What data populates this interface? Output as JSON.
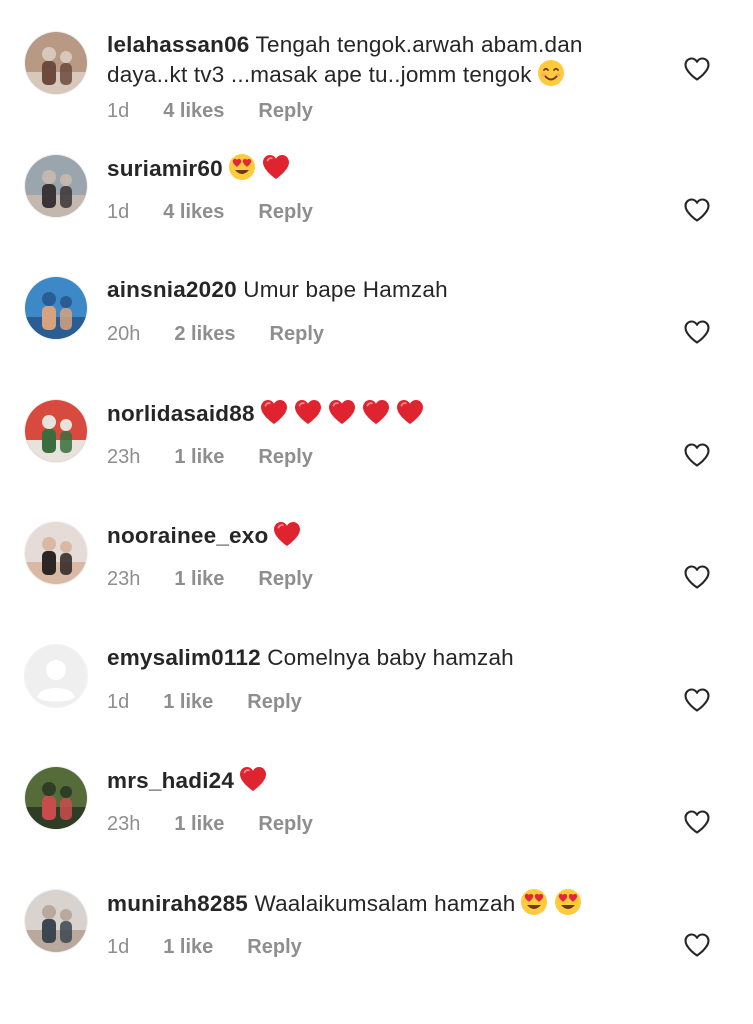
{
  "comments": [
    {
      "username": "lelahassan06",
      "text": "Tengah tengok.arwah abam.dan daya..kt  tv3 ...masak ape tu..jomm tengok",
      "emojis": [
        "smiling-face-emoji"
      ],
      "time": "1d",
      "likes": "4 likes",
      "reply": "Reply",
      "avatar_colors": [
        "#b89a84",
        "#6d4a3c",
        "#d7c8bb"
      ]
    },
    {
      "username": "suriamir60",
      "text": "",
      "emojis": [
        "heart-eyes-emoji",
        "red-heart-emoji"
      ],
      "time": "1d",
      "likes": "4 likes",
      "reply": "Reply",
      "avatar_colors": [
        "#9aa5ad",
        "#3b3436",
        "#c4b8ae"
      ]
    },
    {
      "username": "ainsnia2020",
      "text": "Umur bape Hamzah",
      "emojis": [],
      "time": "20h",
      "likes": "2 likes",
      "reply": "Reply",
      "avatar_colors": [
        "#3d88c7",
        "#d7a27d",
        "#2a5d93"
      ]
    },
    {
      "username": "norlidasaid88",
      "text": "",
      "emojis": [
        "red-heart-emoji",
        "red-heart-emoji",
        "red-heart-emoji",
        "red-heart-emoji",
        "red-heart-emoji"
      ],
      "time": "23h",
      "likes": "1 like",
      "reply": "Reply",
      "avatar_colors": [
        "#d94a3e",
        "#3a6d3d",
        "#e8e2dc"
      ]
    },
    {
      "username": "noorainee_exo",
      "text": "",
      "emojis": [
        "red-heart-emoji"
      ],
      "time": "23h",
      "likes": "1 like",
      "reply": "Reply",
      "avatar_colors": [
        "#e5dcd7",
        "#2d2524",
        "#d9b9a4"
      ]
    },
    {
      "username": "emysalim0112",
      "text": "Comelnya baby hamzah",
      "emojis": [],
      "time": "1d",
      "likes": "1 like",
      "reply": "Reply",
      "avatar_colors": [
        "#eeeeee",
        "#ffffff",
        "#ffffff"
      ]
    },
    {
      "username": "mrs_hadi24",
      "text": "",
      "emojis": [
        "red-heart-emoji"
      ],
      "time": "23h",
      "likes": "1 like",
      "reply": "Reply",
      "avatar_colors": [
        "#556b3a",
        "#c94c4c",
        "#2e3d24"
      ]
    },
    {
      "username": "munirah8285",
      "text": "Waalaikumsalam hamzah",
      "emojis": [
        "heart-eyes-emoji",
        "heart-eyes-emoji"
      ],
      "time": "1d",
      "likes": "1 like",
      "reply": "Reply",
      "avatar_colors": [
        "#d8d3cf",
        "#3c4650",
        "#b9a89c"
      ]
    }
  ]
}
